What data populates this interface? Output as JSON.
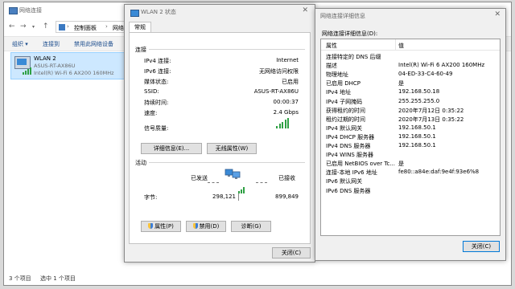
{
  "explorer": {
    "title": "网络连接",
    "address": {
      "seg1": "控制面板",
      "seg2": "网络和 I"
    },
    "toolbar": {
      "organize": "组织",
      "connect_to": "连接到",
      "disable": "禁用此网络设备"
    },
    "item": {
      "name": "WLAN 2",
      "ssid": "ASUS-RT-AX86U",
      "adapter": "Intel(R) Wi-Fi 6 AX200 160MHz"
    },
    "status": {
      "count": "3 个项目",
      "selected": "选中 1 个项目"
    }
  },
  "status_dialog": {
    "title": "WLAN 2 状态",
    "tab": "常规",
    "connection_group": "连接",
    "rows": [
      {
        "label": "IPv4 连接:",
        "value": "Internet"
      },
      {
        "label": "IPv6 连接:",
        "value": "无网络访问权限"
      },
      {
        "label": "媒体状态:",
        "value": "已启用"
      },
      {
        "label": "SSID:",
        "value": "ASUS-RT-AX86U"
      },
      {
        "label": "持续时间:",
        "value": "00:00:37"
      },
      {
        "label": "速度:",
        "value": "2.4 Gbps"
      }
    ],
    "signal_label": "信号质量:",
    "signal_level": 5,
    "details_button": "详细信息(E)...",
    "wireless_button": "无线属性(W)",
    "activity_group": "活动",
    "sent_label": "已发送",
    "received_label": "已接收",
    "bytes_label": "字节:",
    "bytes_sent": "298,121",
    "bytes_received": "899,849",
    "properties_button": "属性(P)",
    "disable_button": "禁用(D)",
    "diagnose_button": "诊断(G)",
    "close_button": "关闭(C)",
    "colors": {
      "signal": "#2ea043",
      "accent": "#0078d7"
    }
  },
  "details_dialog": {
    "title": "网络连接详细信息",
    "caption": "网络连接详细信息(D):",
    "col_property": "属性",
    "col_value": "值",
    "rows": [
      {
        "p": "连接特定的 DNS 后缀",
        "v": ""
      },
      {
        "p": "描述",
        "v": "Intel(R) Wi-Fi 6 AX200 160MHz"
      },
      {
        "p": "物理地址",
        "v": "04-ED-33-C4-60-49"
      },
      {
        "p": "已启用 DHCP",
        "v": "是"
      },
      {
        "p": "IPv4 地址",
        "v": "192.168.50.18"
      },
      {
        "p": "IPv4 子网掩码",
        "v": "255.255.255.0"
      },
      {
        "p": "获得租约的时间",
        "v": "2020年7月12日 0:35:22"
      },
      {
        "p": "租约过期的时间",
        "v": "2020年7月13日 0:35:22"
      },
      {
        "p": "IPv4 默认网关",
        "v": "192.168.50.1"
      },
      {
        "p": "IPv4 DHCP 服务器",
        "v": "192.168.50.1"
      },
      {
        "p": "IPv4 DNS 服务器",
        "v": "192.168.50.1"
      },
      {
        "p": "IPv4 WINS 服务器",
        "v": ""
      },
      {
        "p": "已启用 NetBIOS over Tc...",
        "v": "是"
      },
      {
        "p": "连接-本地 IPv6 地址",
        "v": "fe80::a84e:daf:9e4f:93e6%8"
      },
      {
        "p": "IPv6 默认网关",
        "v": ""
      },
      {
        "p": "IPv6 DNS 服务器",
        "v": ""
      }
    ],
    "close_button": "关闭(C)"
  }
}
